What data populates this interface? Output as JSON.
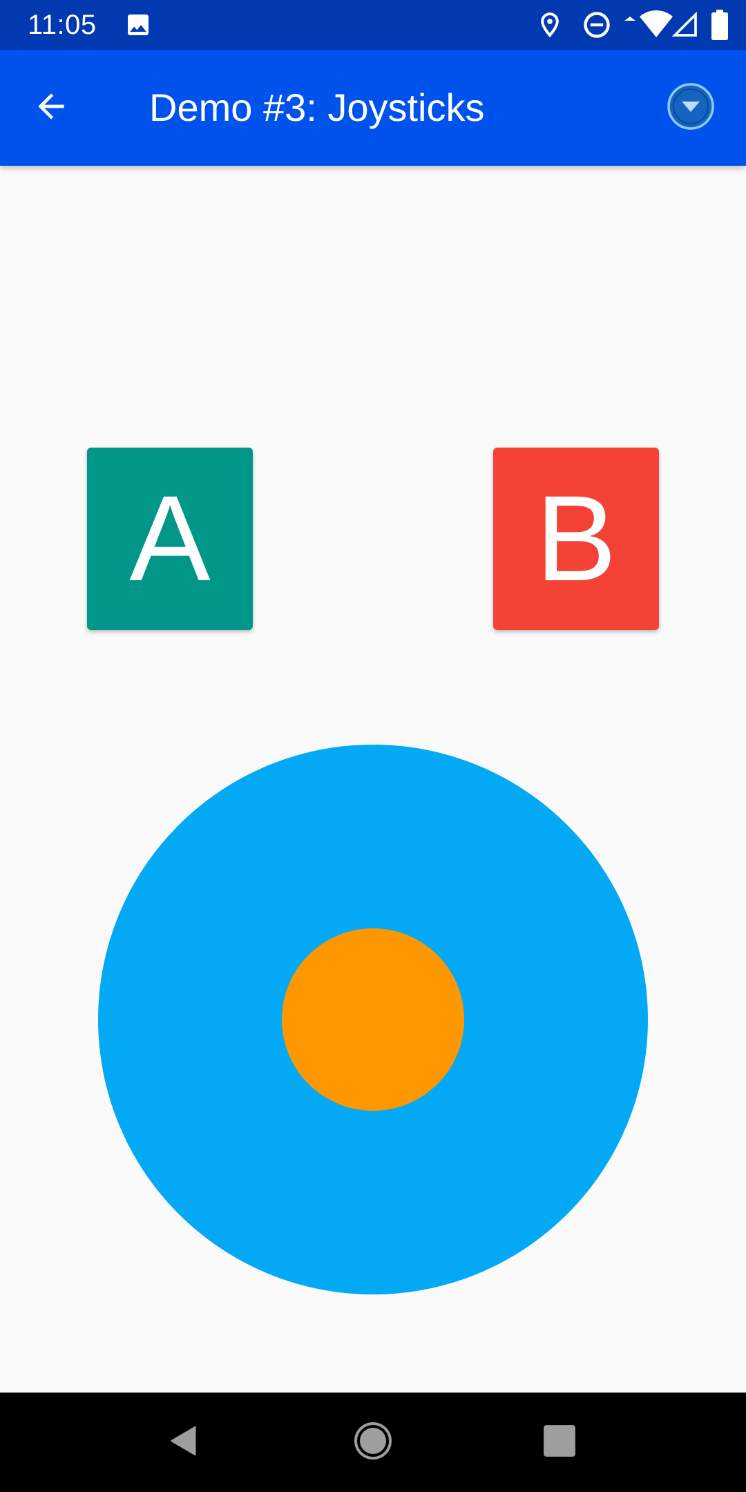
{
  "status_bar": {
    "time": "11:05",
    "icons": [
      "image-icon",
      "location-icon",
      "do-not-disturb-icon",
      "wifi-icon",
      "signal-icon",
      "battery-icon"
    ]
  },
  "app_bar": {
    "title": "Demo #3: Joysticks",
    "back_icon": "arrow-back-icon",
    "menu_icon": "dropdown-circle-icon"
  },
  "controls": {
    "button_a_label": "A",
    "button_b_label": "B"
  },
  "colors": {
    "status_bar": "#0039b0",
    "app_bar": "#0052ec",
    "button_a": "#009688",
    "button_b": "#f44336",
    "joystick_base": "#03a9f4",
    "joystick_knob": "#ff9800",
    "background": "#fafafa"
  },
  "nav_bar": {
    "icons": [
      "nav-back-icon",
      "nav-home-icon",
      "nav-recents-icon"
    ]
  }
}
